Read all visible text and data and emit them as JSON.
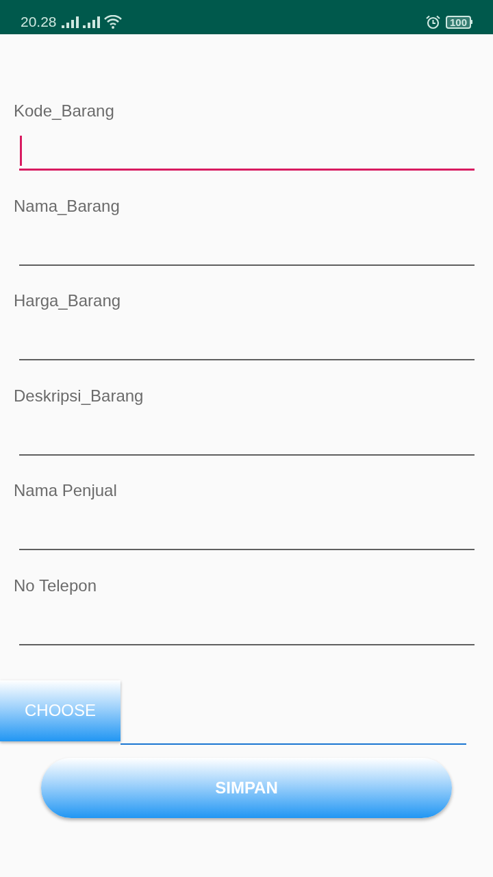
{
  "status_bar": {
    "time": "20.28",
    "battery": "100"
  },
  "form": {
    "fields": [
      {
        "label": "Kode_Barang",
        "focused": true
      },
      {
        "label": "Nama_Barang",
        "focused": false
      },
      {
        "label": "Harga_Barang",
        "focused": false
      },
      {
        "label": "Deskripsi_Barang",
        "focused": false
      },
      {
        "label": "Nama Penjual",
        "focused": false
      },
      {
        "label": "No Telepon",
        "focused": false
      }
    ]
  },
  "image_picker": {
    "button": "CHOOSE"
  },
  "save_button": "SIMPAN"
}
